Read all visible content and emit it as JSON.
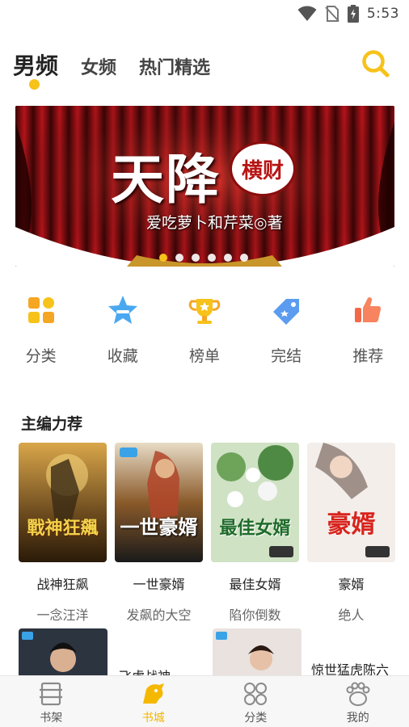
{
  "status_bar": {
    "time": "5:53",
    "icons": [
      "wifi-icon",
      "no-sim-icon",
      "battery-charging-icon"
    ]
  },
  "top_tabs": [
    {
      "label": "男频",
      "active": true
    },
    {
      "label": "女频",
      "active": false
    },
    {
      "label": "热门精选",
      "active": false
    }
  ],
  "accent_color": "#f7c21a",
  "banner": {
    "title": "天降",
    "seal_text": "横财",
    "author_line": "爱吃萝卜和芹菜◎著",
    "dots": 6,
    "active_dot": 0
  },
  "quick_nav": [
    {
      "label": "分类",
      "icon": "category-icon"
    },
    {
      "label": "收藏",
      "icon": "star-bookmark-icon"
    },
    {
      "label": "榜单",
      "icon": "trophy-icon"
    },
    {
      "label": "完结",
      "icon": "tag-icon"
    },
    {
      "label": "推荐",
      "icon": "thumbs-up-icon"
    }
  ],
  "section": {
    "title": "主编力荐"
  },
  "books": [
    {
      "title": "战神狂飙",
      "author": "一念汪洋",
      "cover_text": "戰神狂飆"
    },
    {
      "title": "一世豪婿",
      "author": "发飙的大空",
      "cover_text": "一世豪婿"
    },
    {
      "title": "最佳女婿",
      "author": "陷你倒数",
      "cover_text": "最佳女婿"
    },
    {
      "title": "豪婿",
      "author": "绝人",
      "cover_text": "豪婿"
    }
  ],
  "books_row2": [
    {
      "title": "飞虎战神"
    },
    {
      "title": "惊世猛虎陈六"
    }
  ],
  "bottom_nav": [
    {
      "label": "书架",
      "icon": "bookshelf-icon",
      "active": false
    },
    {
      "label": "书城",
      "icon": "bookstore-icon",
      "active": true
    },
    {
      "label": "分类",
      "icon": "grid-category-icon",
      "active": false
    },
    {
      "label": "我的",
      "icon": "paw-profile-icon",
      "active": false
    }
  ]
}
